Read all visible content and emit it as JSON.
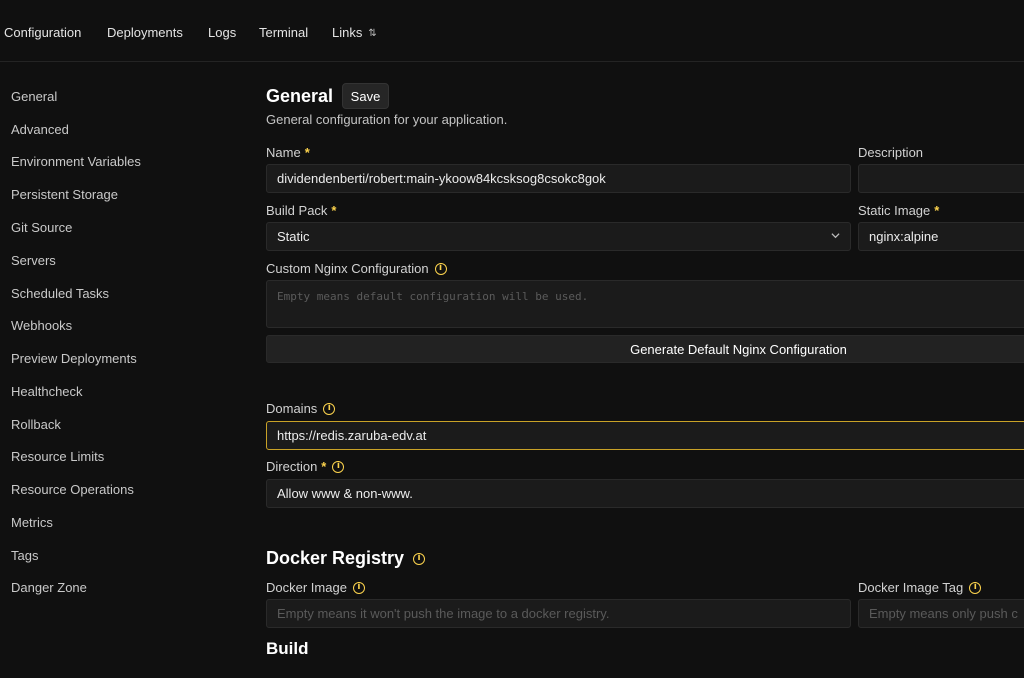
{
  "topnav": {
    "items": [
      "Configuration",
      "Deployments",
      "Logs",
      "Terminal",
      "Links"
    ]
  },
  "sidebar": {
    "items": [
      "General",
      "Advanced",
      "Environment Variables",
      "Persistent Storage",
      "Git Source",
      "Servers",
      "Scheduled Tasks",
      "Webhooks",
      "Preview Deployments",
      "Healthcheck",
      "Rollback",
      "Resource Limits",
      "Resource Operations",
      "Metrics",
      "Tags",
      "Danger Zone"
    ]
  },
  "general": {
    "title": "General",
    "save_label": "Save",
    "subtitle": "General configuration for your application.",
    "name_label": "Name",
    "name_value": "dividendenberti/robert:main-ykoow84kcsksog8csokc8gok",
    "description_label": "Description",
    "description_value": "",
    "build_pack_label": "Build Pack",
    "build_pack_value": "Static",
    "static_image_label": "Static Image",
    "static_image_value": "nginx:alpine",
    "nginx_label": "Custom Nginx Configuration",
    "nginx_placeholder": "Empty means default configuration will be used.",
    "generate_button": "Generate Default Nginx Configuration",
    "domains_label": "Domains",
    "domains_value": "https://redis.zaruba-edv.at",
    "direction_label": "Direction",
    "direction_value": "Allow www & non-www."
  },
  "docker_registry": {
    "title": "Docker Registry",
    "image_label": "Docker Image",
    "image_placeholder": "Empty means it won't push the image to a docker registry.",
    "tag_label": "Docker Image Tag",
    "tag_placeholder": "Empty means only push c"
  },
  "build": {
    "title": "Build"
  },
  "colors": {
    "background": "#101010",
    "accent": "#fcd34d",
    "focus_border": "#c9a227"
  },
  "icons": [
    "chevron-up-down-icon",
    "info-icon",
    "chevron-down-icon"
  ]
}
